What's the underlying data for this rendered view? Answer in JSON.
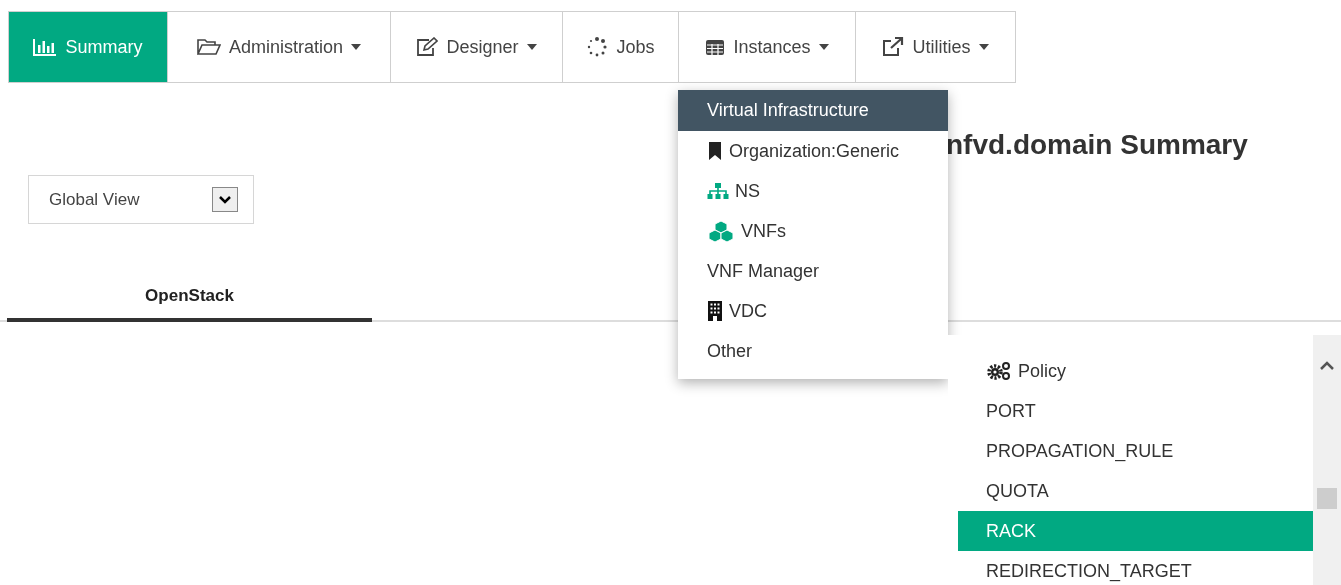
{
  "nav": [
    {
      "label": "Summary",
      "kind": "chart",
      "dropdown": false,
      "selected": true
    },
    {
      "label": "Administration",
      "kind": "folder",
      "dropdown": true,
      "selected": false
    },
    {
      "label": "Designer",
      "kind": "edit",
      "dropdown": true,
      "selected": false
    },
    {
      "label": "Jobs",
      "kind": "spinner",
      "dropdown": false,
      "selected": false
    },
    {
      "label": "Instances",
      "kind": "table",
      "dropdown": true,
      "selected": false
    },
    {
      "label": "Utilities",
      "kind": "external",
      "dropdown": true,
      "selected": false
    }
  ],
  "instances_menu": [
    {
      "label": "Virtual Infrastructure",
      "kind": "plain",
      "selected": true
    },
    {
      "label": "Organization:Generic",
      "kind": "bookmark",
      "selected": false
    },
    {
      "label": "NS",
      "kind": "sitemap",
      "selected": false
    },
    {
      "label": "VNFs",
      "kind": "cubes",
      "selected": false
    },
    {
      "label": "VNF Manager",
      "kind": "plain",
      "selected": false
    },
    {
      "label": "VDC",
      "kind": "building",
      "selected": false
    },
    {
      "label": "Other",
      "kind": "plain",
      "selected": false
    }
  ],
  "page_title": "nfvd.domain Summary",
  "view_select": {
    "value": "Global View"
  },
  "tabs": [
    {
      "label": "OpenStack",
      "selected": true
    }
  ],
  "type_list": [
    {
      "label": "Policy",
      "kind": "gears",
      "selected": false
    },
    {
      "label": "PORT",
      "kind": "plain",
      "selected": false
    },
    {
      "label": "PROPAGATION_RULE",
      "kind": "plain",
      "selected": false
    },
    {
      "label": "QUOTA",
      "kind": "plain",
      "selected": false
    },
    {
      "label": "RACK",
      "kind": "plain",
      "selected": true
    },
    {
      "label": "REDIRECTION_TARGET",
      "kind": "plain",
      "selected": false
    }
  ]
}
